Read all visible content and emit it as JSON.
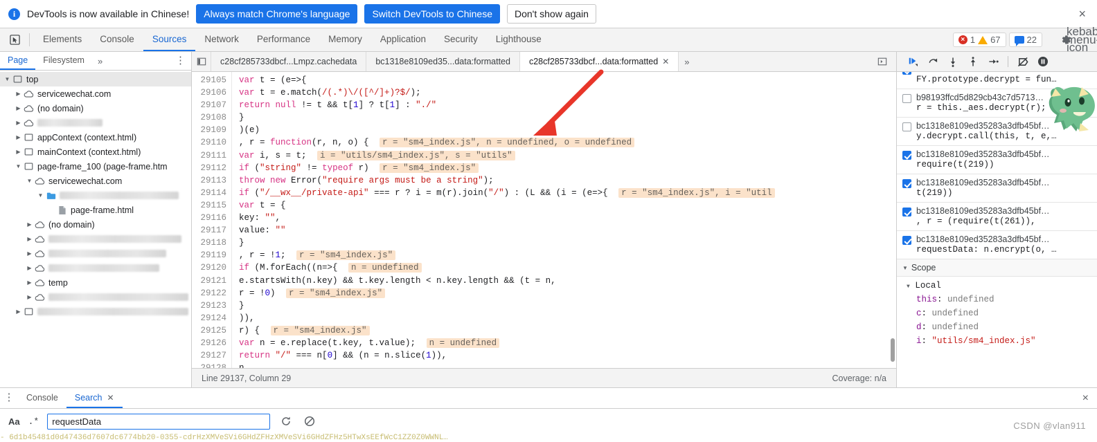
{
  "infobar": {
    "icon": "info-icon",
    "message": "DevTools is now available in Chinese!",
    "primary_button": "Always match Chrome's language",
    "secondary_button": "Switch DevTools to Chinese",
    "dismiss_button": "Don't show again",
    "close_icon": "×"
  },
  "main_tabs": {
    "inspect_icon": "inspect-cursor-icon",
    "items": [
      {
        "label": "Elements",
        "active": false
      },
      {
        "label": "Console",
        "active": false
      },
      {
        "label": "Sources",
        "active": true
      },
      {
        "label": "Network",
        "active": false
      },
      {
        "label": "Performance",
        "active": false
      },
      {
        "label": "Memory",
        "active": false
      },
      {
        "label": "Application",
        "active": false
      },
      {
        "label": "Security",
        "active": false
      },
      {
        "label": "Lighthouse",
        "active": false
      }
    ],
    "error_count": "1",
    "warning_count": "67",
    "message_count": "22",
    "settings_icon": "gear-icon",
    "more_icon": "kebab-menu-icon"
  },
  "navigator": {
    "tabs": [
      {
        "label": "Page",
        "active": true
      },
      {
        "label": "Filesystem",
        "active": false
      }
    ],
    "more_label": "»",
    "kebab": "⋮",
    "tree": [
      {
        "indent": 0,
        "arrow": "open",
        "icon": "frame-icon",
        "label": "top",
        "selected": true,
        "redacted": false
      },
      {
        "indent": 1,
        "arrow": "closed",
        "icon": "cloud-icon",
        "label": "servicewechat.com",
        "selected": false,
        "redacted": false
      },
      {
        "indent": 1,
        "arrow": "closed",
        "icon": "cloud-icon",
        "label": "(no domain)",
        "selected": false,
        "redacted": false
      },
      {
        "indent": 1,
        "arrow": "closed",
        "icon": "cloud-icon",
        "label": "",
        "selected": false,
        "redacted": true,
        "redact_w": 94
      },
      {
        "indent": 1,
        "arrow": "closed",
        "icon": "frame-icon",
        "label": "appContext (context.html)",
        "selected": false,
        "redacted": false
      },
      {
        "indent": 1,
        "arrow": "closed",
        "icon": "frame-icon",
        "label": "mainContext (context.html)",
        "selected": false,
        "redacted": false
      },
      {
        "indent": 1,
        "arrow": "open",
        "icon": "frame-icon",
        "label": "page-frame_100 (page-frame.htm",
        "selected": false,
        "redacted": false
      },
      {
        "indent": 2,
        "arrow": "open",
        "icon": "cloud-icon",
        "label": "servicewechat.com",
        "selected": false,
        "redacted": false
      },
      {
        "indent": 3,
        "arrow": "open",
        "icon": "folder-icon",
        "label": "",
        "selected": false,
        "redacted": true,
        "redact_w": 172
      },
      {
        "indent": 4,
        "arrow": "none",
        "icon": "file-icon",
        "label": "page-frame.html",
        "selected": false,
        "redacted": false
      },
      {
        "indent": 2,
        "arrow": "closed",
        "icon": "cloud-icon",
        "label": "(no domain)",
        "selected": false,
        "redacted": false
      },
      {
        "indent": 2,
        "arrow": "closed",
        "icon": "cloud-icon",
        "label": "",
        "selected": false,
        "redacted": true,
        "redact_w": 192
      },
      {
        "indent": 2,
        "arrow": "closed",
        "icon": "cloud-icon",
        "label": "",
        "selected": false,
        "redacted": true,
        "redact_w": 170
      },
      {
        "indent": 2,
        "arrow": "closed",
        "icon": "cloud-icon",
        "label": "",
        "selected": false,
        "redacted": true,
        "redact_w": 160
      },
      {
        "indent": 2,
        "arrow": "closed",
        "icon": "cloud-icon",
        "label": "temp",
        "selected": false,
        "redacted": false
      },
      {
        "indent": 2,
        "arrow": "closed",
        "icon": "cloud-icon",
        "label": "",
        "selected": false,
        "redacted": true,
        "redact_w": 218
      },
      {
        "indent": 1,
        "arrow": "closed",
        "icon": "frame-icon",
        "label": "",
        "selected": false,
        "redacted": true,
        "redact_w": 218
      }
    ]
  },
  "file_tabs": {
    "nav_icon": "panel-collapse-icon",
    "items": [
      {
        "label": "c28cf285733dbcf...Lmpz.cachedata",
        "active": false,
        "closable": false
      },
      {
        "label": "bc1318e8109ed35...data:formatted",
        "active": false,
        "closable": false
      },
      {
        "label": "c28cf285733dbcf...data:formatted",
        "active": true,
        "closable": true
      }
    ],
    "overflow_label": "»",
    "show_navigator_icon": "show-navigator-icon"
  },
  "editor": {
    "first_line": 29105,
    "lines": [
      {
        "num": "29105",
        "segments": [
          {
            "t": "            ",
            "c": "pl"
          },
          {
            "t": "var",
            "c": "kw"
          },
          {
            "t": " t = (e=>{",
            "c": "pl"
          }
        ]
      },
      {
        "num": "29106",
        "segments": [
          {
            "t": "                ",
            "c": "pl"
          },
          {
            "t": "var",
            "c": "kw"
          },
          {
            "t": " t = e.match(",
            "c": "pl"
          },
          {
            "t": "/(.*)\\/([^/]+)?$/",
            "c": "rx"
          },
          {
            "t": ");",
            "c": "pl"
          }
        ]
      },
      {
        "num": "29107",
        "segments": [
          {
            "t": "                ",
            "c": "pl"
          },
          {
            "t": "return",
            "c": "kw"
          },
          {
            "t": " ",
            "c": "pl"
          },
          {
            "t": "null",
            "c": "kw"
          },
          {
            "t": " != t && t[",
            "c": "pl"
          },
          {
            "t": "1",
            "c": "num"
          },
          {
            "t": "] ? t[",
            "c": "pl"
          },
          {
            "t": "1",
            "c": "num"
          },
          {
            "t": "] : ",
            "c": "pl"
          },
          {
            "t": "\"./\"",
            "c": "str"
          }
        ]
      },
      {
        "num": "29108",
        "segments": [
          {
            "t": "            }",
            "c": "pl"
          }
        ]
      },
      {
        "num": "29109",
        "segments": [
          {
            "t": "            )(e)",
            "c": "pl"
          }
        ]
      },
      {
        "num": "29110",
        "segments": [
          {
            "t": "              , r = ",
            "c": "pl"
          },
          {
            "t": "function",
            "c": "kw"
          },
          {
            "t": "(r, n, o) { ",
            "c": "pl"
          }
        ],
        "hint": "r = \"sm4_index.js\", n = undefined, o = undefined"
      },
      {
        "num": "29111",
        "segments": [
          {
            "t": "              ",
            "c": "pl"
          },
          {
            "t": "var",
            "c": "kw"
          },
          {
            "t": " i, s = t; ",
            "c": "pl"
          }
        ],
        "hint": "i = \"utils/sm4_index.js\", s = \"utils\""
      },
      {
        "num": "29112",
        "segments": [
          {
            "t": "              ",
            "c": "pl"
          },
          {
            "t": "if",
            "c": "kw"
          },
          {
            "t": " (",
            "c": "pl"
          },
          {
            "t": "\"string\"",
            "c": "str"
          },
          {
            "t": " != ",
            "c": "pl"
          },
          {
            "t": "typeof",
            "c": "kw"
          },
          {
            "t": " r) ",
            "c": "pl"
          }
        ],
        "hint": "r = \"sm4_index.js\""
      },
      {
        "num": "29113",
        "segments": [
          {
            "t": "                  ",
            "c": "pl"
          },
          {
            "t": "throw",
            "c": "kw"
          },
          {
            "t": " ",
            "c": "pl"
          },
          {
            "t": "new",
            "c": "kw"
          },
          {
            "t": " Error(",
            "c": "pl"
          },
          {
            "t": "\"require args must be a string\"",
            "c": "str"
          },
          {
            "t": ");",
            "c": "pl"
          }
        ]
      },
      {
        "num": "29114",
        "segments": [
          {
            "t": "              ",
            "c": "pl"
          },
          {
            "t": "if",
            "c": "kw"
          },
          {
            "t": " (",
            "c": "pl"
          },
          {
            "t": "\"/__wx__/private-api\"",
            "c": "str"
          },
          {
            "t": " === r ? i = m(r).join(",
            "c": "pl"
          },
          {
            "t": "\"/\"",
            "c": "str"
          },
          {
            "t": ") : (L && (i = (e=>{ ",
            "c": "pl"
          }
        ],
        "hint": "r = \"sm4_index.js\", i = \"util"
      },
      {
        "num": "29115",
        "segments": [
          {
            "t": "                  ",
            "c": "pl"
          },
          {
            "t": "var",
            "c": "kw"
          },
          {
            "t": " t = {",
            "c": "pl"
          }
        ]
      },
      {
        "num": "29116",
        "segments": [
          {
            "t": "                      key: ",
            "c": "pl"
          },
          {
            "t": "\"\"",
            "c": "str"
          },
          {
            "t": ",",
            "c": "pl"
          }
        ]
      },
      {
        "num": "29117",
        "segments": [
          {
            "t": "                      value: ",
            "c": "pl"
          },
          {
            "t": "\"\"",
            "c": "str"
          }
        ]
      },
      {
        "num": "29118",
        "segments": [
          {
            "t": "                  }",
            "c": "pl"
          }
        ]
      },
      {
        "num": "29119",
        "segments": [
          {
            "t": "                    , r = !",
            "c": "pl"
          },
          {
            "t": "1",
            "c": "num"
          },
          {
            "t": "; ",
            "c": "pl"
          }
        ],
        "hint": "r = \"sm4_index.js\""
      },
      {
        "num": "29120",
        "segments": [
          {
            "t": "                  ",
            "c": "pl"
          },
          {
            "t": "if",
            "c": "kw"
          },
          {
            "t": " (M.forEach((n=>{ ",
            "c": "pl"
          }
        ],
        "hint": "n = undefined"
      },
      {
        "num": "29121",
        "segments": [
          {
            "t": "                      e.startsWith(n.key) && t.key.length < n.key.length && (t = n,",
            "c": "pl"
          }
        ]
      },
      {
        "num": "29122",
        "segments": [
          {
            "t": "                      r = !",
            "c": "pl"
          },
          {
            "t": "0",
            "c": "num"
          },
          {
            "t": ") ",
            "c": "pl"
          }
        ],
        "hint": "r = \"sm4_index.js\""
      },
      {
        "num": "29123",
        "segments": [
          {
            "t": "                  }",
            "c": "pl"
          }
        ]
      },
      {
        "num": "29124",
        "segments": [
          {
            "t": "                  )),",
            "c": "pl"
          }
        ]
      },
      {
        "num": "29125",
        "segments": [
          {
            "t": "                  r) { ",
            "c": "pl"
          }
        ],
        "hint": "r = \"sm4_index.js\""
      },
      {
        "num": "29126",
        "segments": [
          {
            "t": "                      ",
            "c": "pl"
          },
          {
            "t": "var",
            "c": "kw"
          },
          {
            "t": " n = e.replace(t.key, t.value); ",
            "c": "pl"
          }
        ],
        "hint": "n = undefined"
      },
      {
        "num": "29127",
        "segments": [
          {
            "t": "                      ",
            "c": "pl"
          },
          {
            "t": "return",
            "c": "kw"
          },
          {
            "t": " ",
            "c": "pl"
          },
          {
            "t": "\"/\"",
            "c": "str"
          },
          {
            "t": " === n[",
            "c": "pl"
          },
          {
            "t": "0",
            "c": "num"
          },
          {
            "t": "] && (n = n.slice(",
            "c": "pl"
          },
          {
            "t": "1",
            "c": "num"
          },
          {
            "t": ")),",
            "c": "pl"
          }
        ]
      },
      {
        "num": "29128",
        "segments": [
          {
            "t": "                          n",
            "c": "pl"
          }
        ]
      }
    ]
  },
  "statusbar": {
    "position": "Line 29137, Column 29",
    "coverage": "Coverage: n/a"
  },
  "debugger": {
    "controls": [
      {
        "name": "resume-script-execution",
        "icon": "resume-icon"
      },
      {
        "name": "step-over-next-function-call",
        "icon": "step-over-icon"
      },
      {
        "name": "step-into-next-function-call",
        "icon": "step-into-icon"
      },
      {
        "name": "step-out-of-current-function",
        "icon": "step-out-icon"
      },
      {
        "name": "step",
        "icon": "step-icon"
      },
      {
        "name": "deactivate-breakpoints",
        "icon": "deactivate-breakpoints-icon"
      },
      {
        "name": "pause-on-exceptions",
        "icon": "pause-on-exceptions-icon"
      }
    ],
    "breakpoints": [
      {
        "checked": true,
        "file": "bc1318e8109ed35283a3dfb45bf…",
        "code": "FY.prototype.decrypt = fun…",
        "partial": true
      },
      {
        "checked": false,
        "file": "b98193ffcd5d829cb43c7d5713…",
        "code": "r = this._aes.decrypt(r);"
      },
      {
        "checked": false,
        "file": "bc1318e8109ed35283a3dfb45bf…",
        "code": "y.decrypt.call(this, t, e,…"
      },
      {
        "checked": true,
        "file": "bc1318e8109ed35283a3dfb45bf…",
        "code": "require(t(219))"
      },
      {
        "checked": true,
        "file": "bc1318e8109ed35283a3dfb45bf…",
        "code": "t(219))"
      },
      {
        "checked": true,
        "file": "bc1318e8109ed35283a3dfb45bf…",
        "code": ", r = (require(t(261)),"
      },
      {
        "checked": true,
        "file": "bc1318e8109ed35283a3dfb45bf…",
        "code": "requestData: n.encrypt(o, …"
      }
    ],
    "scope_header": "Scope",
    "scope_group": "Local",
    "scope_vars": [
      {
        "key": "this",
        "value": "undefined",
        "kind": "undefined"
      },
      {
        "key": "c",
        "value": "undefined",
        "kind": "undefined"
      },
      {
        "key": "d",
        "value": "undefined",
        "kind": "undefined"
      },
      {
        "key": "i",
        "value": "\"utils/sm4_index.js\"",
        "kind": "string"
      }
    ]
  },
  "drawer": {
    "kebab": "⋮",
    "tabs": [
      {
        "label": "Console",
        "active": false,
        "closable": false
      },
      {
        "label": "Search",
        "active": true,
        "closable": true
      }
    ],
    "close_icon": "×",
    "match_case_label": "Aa",
    "regex_label": ".*",
    "search_value": "requestData",
    "search_placeholder": "Search",
    "refresh_icon": "refresh-icon",
    "clear_icon": "clear-icon",
    "result_line": "-  6d1b45481d0d47436d7607dc6774bb20-0355-cdrHzXMVeSVi6GHdZFHzXMVeSVi6GHdZFHz5HTwXsEEfWcC1ZZ0Z0WWNL…"
  },
  "watermark": "CSDN @vlan911",
  "annotation": {
    "red_arrow": "red-arrow-pointing-to-inline-hint"
  },
  "colors": {
    "accent": "#1a73e8",
    "error": "#d93025",
    "warning": "#f9ab00",
    "hint_bg": "#fbe2ca",
    "string": "#c41a16",
    "keyword": "#d63384",
    "number": "#1c00cf",
    "arrow": "#e8362a"
  }
}
